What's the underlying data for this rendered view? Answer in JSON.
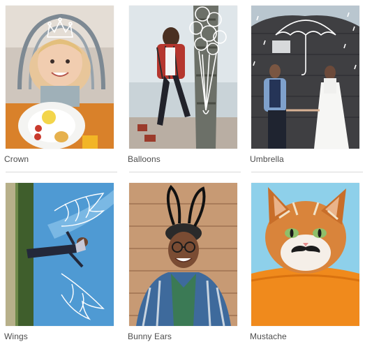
{
  "gallery": {
    "items": [
      {
        "label": "Crown",
        "icon": "crown-doodle"
      },
      {
        "label": "Balloons",
        "icon": "balloons-doodle"
      },
      {
        "label": "Umbrella",
        "icon": "umbrella-doodle"
      },
      {
        "label": "Wings",
        "icon": "wings-doodle"
      },
      {
        "label": "Bunny Ears",
        "icon": "bunny-ears-doodle"
      },
      {
        "label": "Mustache",
        "icon": "mustache-doodle"
      }
    ]
  }
}
